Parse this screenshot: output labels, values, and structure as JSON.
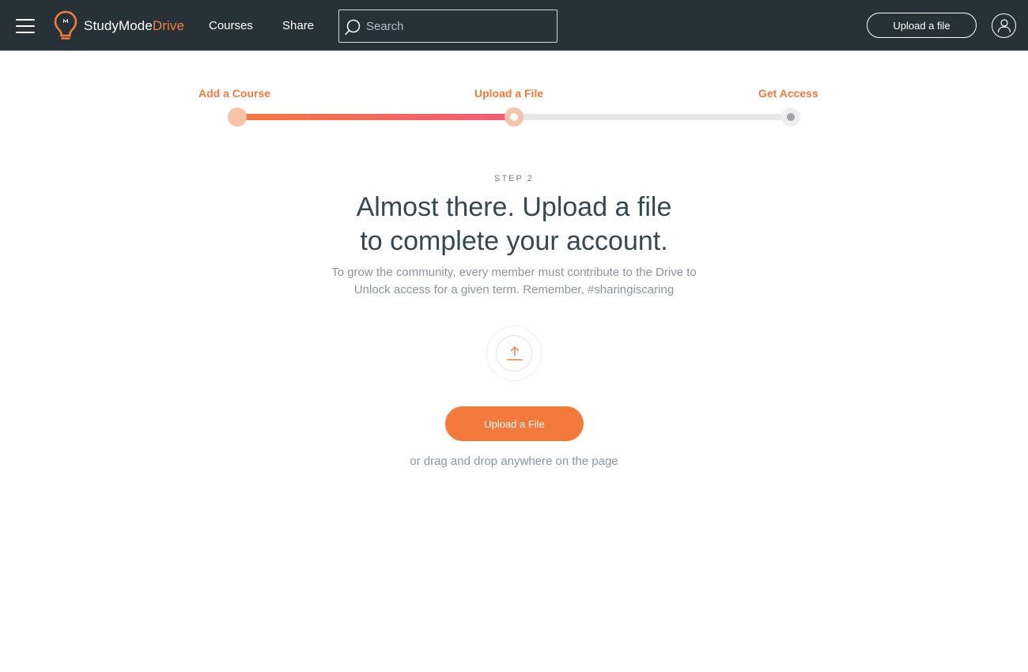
{
  "header": {
    "logo": {
      "brand_primary": "StudyMode",
      "brand_accent": "Drive"
    },
    "nav": [
      {
        "label": "Courses"
      },
      {
        "label": "Share"
      }
    ],
    "search": {
      "placeholder": "Search",
      "value": ""
    },
    "upload_label": "Upload a file"
  },
  "progress": {
    "steps": [
      {
        "label": "Add a Course"
      },
      {
        "label": "Upload a File"
      },
      {
        "label": "Get Access"
      }
    ],
    "current_step": 2,
    "fill_percent": 50
  },
  "main": {
    "step_label": "STEP 2",
    "headline_line1": "Almost there. Upload a file",
    "headline_line2": "to complete your account.",
    "subtext_line1": "To grow the community, every member must contribute to the Drive to",
    "subtext_line2": "Unlock access for a given term. Remember, #sharingiscaring",
    "upload_button": "Upload a File",
    "drag_hint": "or drag and drop anywhere on the page"
  },
  "colors": {
    "header_bg": "#263238",
    "accent": "#f47a3c",
    "gradient_end": "#f35a7a",
    "track": "#e5e7e9"
  }
}
